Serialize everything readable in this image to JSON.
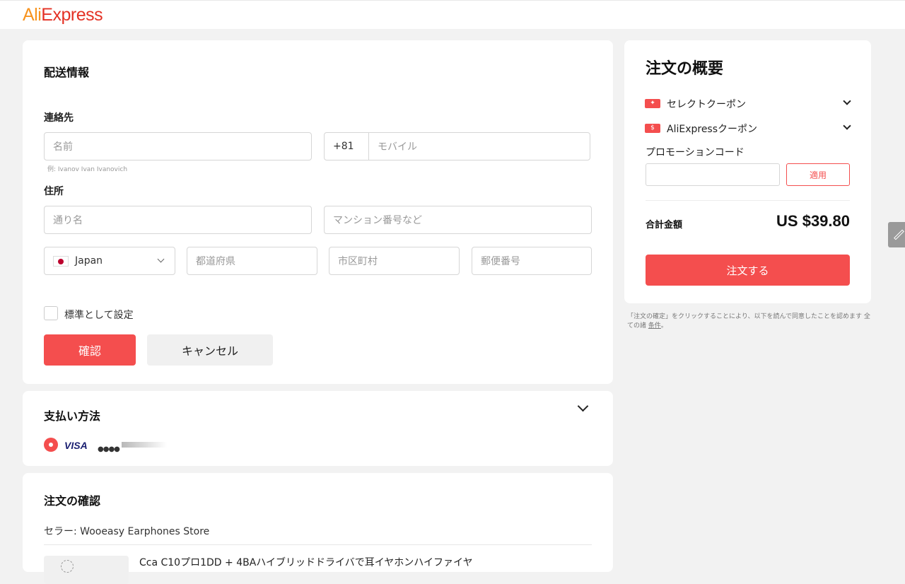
{
  "header": {
    "logo_ali": "Ali",
    "logo_express": "Express"
  },
  "shipping": {
    "title": "配送情報",
    "contact_label": "連絡先",
    "name_placeholder": "名前",
    "name_hint": "例: Ivanov Ivan Ivanovich",
    "phone_code": "+81",
    "mobile_placeholder": "モバイル",
    "address_label": "住所",
    "street_placeholder": "通り名",
    "apartment_placeholder": "マンション番号など",
    "country": "Japan",
    "prefecture_placeholder": "都道府県",
    "city_placeholder": "市区町村",
    "postal_placeholder": "郵便番号",
    "default_checkbox_label": "標準として設定",
    "confirm_label": "確認",
    "cancel_label": "キャンセル"
  },
  "payment": {
    "title": "支払い方法",
    "card_brand": "VISA",
    "card_mask": "●●●●"
  },
  "review": {
    "title": "注文の確認",
    "seller": "セラー: Wooeasy Earphones Store",
    "product_title": "Cca C10プロ1DD + 4BAハイブリッドドライバで耳イヤホンハイファイヤ"
  },
  "summary": {
    "title": "注文の概要",
    "select_coupon": "セレクトクーポン",
    "ali_coupon": "AliExpressクーポン",
    "promo_label": "プロモーションコード",
    "apply_label": "適用",
    "total_label": "合計金額",
    "total_value": "US $39.80",
    "order_label": "注文する",
    "terms_text": "「注文の確定」をクリックすることにより、以下を読んで同意したことを認めます 全ての諸 ",
    "terms_link": "条件",
    "terms_end": "。"
  },
  "colors": {
    "accent": "#f44e4e",
    "logo": "#e43225"
  }
}
